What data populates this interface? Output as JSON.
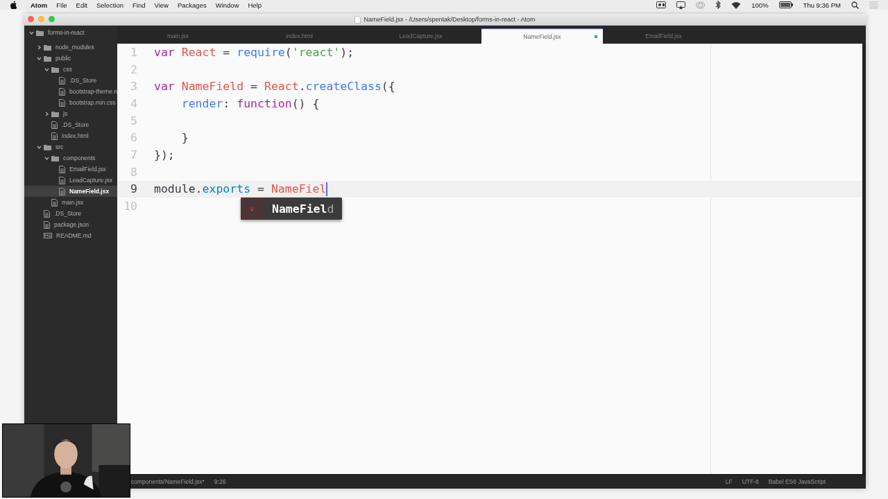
{
  "menubar": {
    "app": "Atom",
    "menus": [
      "File",
      "Edit",
      "Selection",
      "Find",
      "View",
      "Packages",
      "Window",
      "Help"
    ],
    "battery": "100%",
    "clock": "Thu 9:36 PM"
  },
  "window": {
    "title": "NameField.jsx - /Users/spentak/Desktop/forms-in-react - Atom"
  },
  "tabs": [
    {
      "label": "main.jsx",
      "selected": false,
      "modified": false
    },
    {
      "label": "index.html",
      "selected": false,
      "modified": false
    },
    {
      "label": "LeadCapture.jsx",
      "selected": false,
      "modified": false
    },
    {
      "label": "NameField.jsx",
      "selected": true,
      "modified": true
    },
    {
      "label": "EmailField.jsx",
      "selected": false,
      "modified": false
    }
  ],
  "tree": [
    {
      "name": "forms-in-react",
      "kind": "folder",
      "expanded": true,
      "selected": false,
      "children": [
        {
          "name": "node_modules",
          "kind": "folder",
          "expanded": false,
          "selected": false
        },
        {
          "name": "public",
          "kind": "folder",
          "expanded": true,
          "selected": false,
          "children": [
            {
              "name": "css",
              "kind": "folder",
              "expanded": true,
              "selected": false,
              "children": [
                {
                  "name": ".DS_Store",
                  "kind": "file",
                  "selected": false
                },
                {
                  "name": "bootstrap-theme.n",
                  "kind": "file",
                  "selected": false
                },
                {
                  "name": "bootstrap.min.css",
                  "kind": "file",
                  "selected": false
                }
              ]
            },
            {
              "name": "js",
              "kind": "folder",
              "expanded": false,
              "selected": false
            },
            {
              "name": ".DS_Store",
              "kind": "file",
              "selected": false
            },
            {
              "name": "index.html",
              "kind": "file",
              "selected": false
            }
          ]
        },
        {
          "name": "src",
          "kind": "folder",
          "expanded": true,
          "selected": false,
          "children": [
            {
              "name": "components",
              "kind": "folder",
              "expanded": true,
              "selected": false,
              "children": [
                {
                  "name": "EmailField.jsx",
                  "kind": "file",
                  "selected": false
                },
                {
                  "name": "LeadCapture.jsx",
                  "kind": "file",
                  "selected": false
                },
                {
                  "name": "NameField.jsx",
                  "kind": "file",
                  "selected": true
                }
              ]
            },
            {
              "name": "main.jsx",
              "kind": "file",
              "selected": false
            }
          ]
        },
        {
          "name": ".DS_Store",
          "kind": "file",
          "selected": false
        },
        {
          "name": "package.json",
          "kind": "file",
          "selected": false
        },
        {
          "name": "README.md",
          "kind": "markdown",
          "selected": false
        }
      ]
    }
  ],
  "editor": {
    "lines": [
      {
        "number": "1",
        "current": false,
        "tokens": [
          {
            "kind": "keyword",
            "text": "var"
          },
          {
            "kind": "variable",
            "text": " React"
          },
          {
            "kind": "plain",
            "text": " ="
          },
          {
            "kind": "function",
            "text": " require"
          },
          {
            "kind": "plain",
            "text": "("
          },
          {
            "kind": "string",
            "text": "'react'"
          },
          {
            "kind": "plain",
            "text": ");"
          }
        ]
      },
      {
        "number": "2",
        "current": false
      },
      {
        "number": "3",
        "current": false,
        "tokens": [
          {
            "kind": "keyword",
            "text": "var"
          },
          {
            "kind": "variable",
            "text": " NameField"
          },
          {
            "kind": "plain",
            "text": " ="
          },
          {
            "kind": "variable",
            "text": " React"
          },
          {
            "kind": "plain",
            "text": "."
          },
          {
            "kind": "function",
            "text": "createClass"
          },
          {
            "kind": "plain",
            "text": "({"
          }
        ]
      },
      {
        "number": "4",
        "current": false,
        "tokens": [
          {
            "kind": "function",
            "text": "    render"
          },
          {
            "kind": "plain",
            "text": ":"
          },
          {
            "kind": "keyword",
            "text": " function"
          },
          {
            "kind": "plain",
            "text": "() {"
          }
        ]
      },
      {
        "number": "5",
        "current": false
      },
      {
        "number": "6",
        "current": false,
        "tokens": [
          {
            "kind": "plain",
            "text": "    }"
          }
        ]
      },
      {
        "number": "7",
        "current": false,
        "tokens": [
          {
            "kind": "plain",
            "text": "});"
          }
        ]
      },
      {
        "number": "8",
        "current": false
      },
      {
        "number": "9",
        "current": true,
        "tokens": [
          {
            "kind": "plain",
            "text": "module."
          },
          {
            "kind": "property",
            "text": "exports"
          },
          {
            "kind": "plain",
            "text": " ="
          },
          {
            "kind": "variable",
            "text": " NameFiel"
          }
        ]
      },
      {
        "number": "10",
        "current": false
      }
    ],
    "autocomplete": {
      "icon": "v",
      "match": "NameFiel",
      "rest": "d"
    }
  },
  "status_bar": {
    "file": "components/NameField.jsx*",
    "position": "9:26",
    "line_ending": "LF",
    "encoding": "UTF-8",
    "grammar": "Babel ES6 JavaScript"
  }
}
